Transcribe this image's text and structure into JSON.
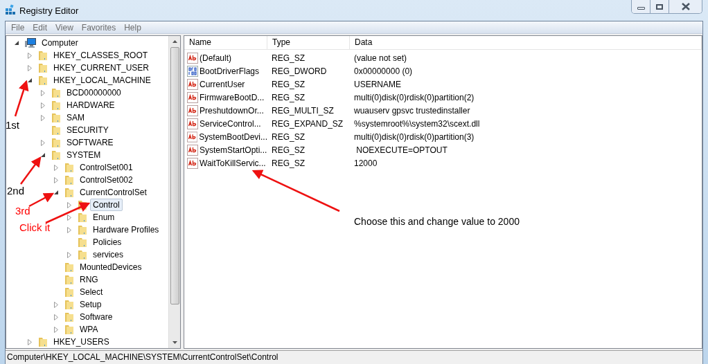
{
  "window": {
    "title": "Registry Editor"
  },
  "menu": [
    "File",
    "Edit",
    "View",
    "Favorites",
    "Help"
  ],
  "tree": [
    {
      "label": "Computer",
      "kind": "computer",
      "expanded": true,
      "selected": false,
      "children": [
        {
          "label": "HKEY_CLASSES_ROOT",
          "kind": "folder",
          "expanded": false,
          "selected": false
        },
        {
          "label": "HKEY_CURRENT_USER",
          "kind": "folder",
          "expanded": false,
          "selected": false
        },
        {
          "label": "HKEY_LOCAL_MACHINE",
          "kind": "folder",
          "expanded": true,
          "selected": false,
          "children": [
            {
              "label": "BCD00000000",
              "kind": "folder",
              "expanded": false,
              "selected": false
            },
            {
              "label": "HARDWARE",
              "kind": "folder",
              "expanded": false,
              "selected": false
            },
            {
              "label": "SAM",
              "kind": "folder",
              "expanded": false,
              "selected": false
            },
            {
              "label": "SECURITY",
              "kind": "folder",
              "selected": false
            },
            {
              "label": "SOFTWARE",
              "kind": "folder",
              "expanded": false,
              "selected": false
            },
            {
              "label": "SYSTEM",
              "kind": "folder",
              "expanded": true,
              "selected": false,
              "children": [
                {
                  "label": "ControlSet001",
                  "kind": "folder",
                  "expanded": false,
                  "selected": false
                },
                {
                  "label": "ControlSet002",
                  "kind": "folder",
                  "expanded": false,
                  "selected": false
                },
                {
                  "label": "CurrentControlSet",
                  "kind": "folder",
                  "expanded": true,
                  "selected": false,
                  "children": [
                    {
                      "label": "Control",
                      "kind": "folder",
                      "expanded": false,
                      "selected": true
                    },
                    {
                      "label": "Enum",
                      "kind": "folder",
                      "expanded": false,
                      "selected": false
                    },
                    {
                      "label": "Hardware Profiles",
                      "kind": "folder",
                      "expanded": false,
                      "selected": false
                    },
                    {
                      "label": "Policies",
                      "kind": "folder",
                      "selected": false
                    },
                    {
                      "label": "services",
                      "kind": "folder",
                      "expanded": false,
                      "selected": false
                    }
                  ]
                },
                {
                  "label": "MountedDevices",
                  "kind": "folder",
                  "selected": false
                },
                {
                  "label": "RNG",
                  "kind": "folder",
                  "selected": false
                },
                {
                  "label": "Select",
                  "kind": "folder",
                  "selected": false
                },
                {
                  "label": "Setup",
                  "kind": "folder",
                  "expanded": false,
                  "selected": false
                },
                {
                  "label": "Software",
                  "kind": "folder",
                  "expanded": false,
                  "selected": false
                },
                {
                  "label": "WPA",
                  "kind": "folder",
                  "expanded": false,
                  "selected": false
                }
              ]
            }
          ]
        },
        {
          "label": "HKEY_USERS",
          "kind": "folder",
          "expanded": false,
          "selected": false
        }
      ]
    }
  ],
  "table": {
    "columns": [
      "Name",
      "Type",
      "Data"
    ],
    "rows": [
      {
        "kind": "string",
        "name": "(Default)",
        "type": "REG_SZ",
        "data": "(value not set)"
      },
      {
        "kind": "binary",
        "name": "BootDriverFlags",
        "type": "REG_DWORD",
        "data": "0x00000000 (0)"
      },
      {
        "kind": "string",
        "name": "CurrentUser",
        "type": "REG_SZ",
        "data": "USERNAME"
      },
      {
        "kind": "string",
        "name": "FirmwareBootD...",
        "type": "REG_SZ",
        "data": "multi(0)disk(0)rdisk(0)partition(2)"
      },
      {
        "kind": "string",
        "name": "PreshutdownOr...",
        "type": "REG_MULTI_SZ",
        "data": "wuauserv gpsvc trustedinstaller"
      },
      {
        "kind": "string",
        "name": "ServiceControl...",
        "type": "REG_EXPAND_SZ",
        "data": "%systemroot%\\system32\\scext.dll"
      },
      {
        "kind": "string",
        "name": "SystemBootDevi...",
        "type": "REG_SZ",
        "data": "multi(0)disk(0)rdisk(0)partition(3)"
      },
      {
        "kind": "string",
        "name": "SystemStartOpti...",
        "type": "REG_SZ",
        "data": " NOEXECUTE=OPTOUT"
      },
      {
        "kind": "string",
        "name": "WaitToKillServic...",
        "type": "REG_SZ",
        "data": "12000"
      }
    ]
  },
  "status_bar": "Computer\\HKEY_LOCAL_MACHINE\\SYSTEM\\CurrentControlSet\\Control",
  "annotations": [
    {
      "text": "1st",
      "color": "#000000"
    },
    {
      "text": "2nd",
      "color": "#000000"
    },
    {
      "text": "3rd",
      "color": "#ff0000"
    },
    {
      "text": "Click it",
      "color": "#ff0000"
    },
    {
      "text": "Choose this and change value to 2000",
      "color": "#000000"
    }
  ]
}
